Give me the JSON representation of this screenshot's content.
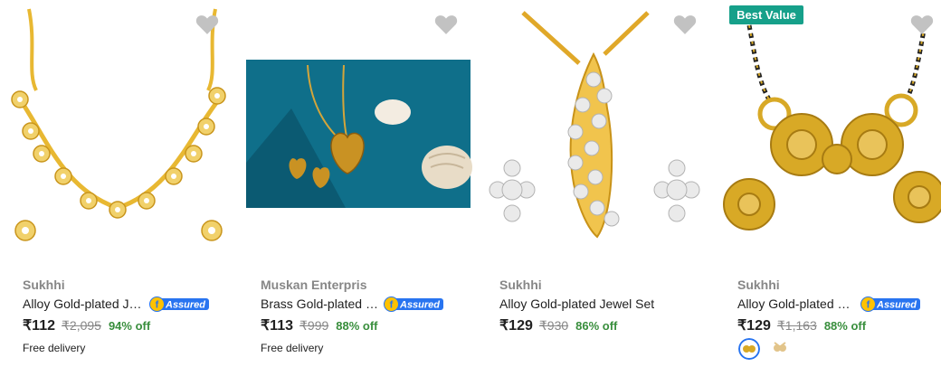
{
  "products": [
    {
      "brand": "Sukhhi",
      "title": "Alloy Gold-plated Jew…",
      "price": "₹112",
      "mrp": "₹2,095",
      "discount": "94% off",
      "delivery": "Free delivery",
      "assured": "Assured"
    },
    {
      "brand": "Muskan Enterpris",
      "title": "Brass Gold-plated J…",
      "price": "₹113",
      "mrp": "₹999",
      "discount": "88% off",
      "delivery": "Free delivery",
      "assured": "Assured"
    },
    {
      "brand": "Sukhhi",
      "title": "Alloy Gold-plated Jewel Set",
      "price": "₹129",
      "mrp": "₹930",
      "discount": "86% off"
    },
    {
      "brand": "Sukhhi",
      "title": "Alloy Gold-plated Je…",
      "price": "₹129",
      "mrp": "₹1,163",
      "discount": "88% off",
      "assured": "Assured",
      "badge": "Best Value"
    }
  ],
  "colors": {
    "accent_green": "#388e3c",
    "assured_blue": "#2874f0",
    "badge_teal": "#16a08a",
    "gold": "#d8a926"
  },
  "icons": {
    "wishlist": "heart-icon",
    "assured": "flipkart-assured-icon"
  }
}
